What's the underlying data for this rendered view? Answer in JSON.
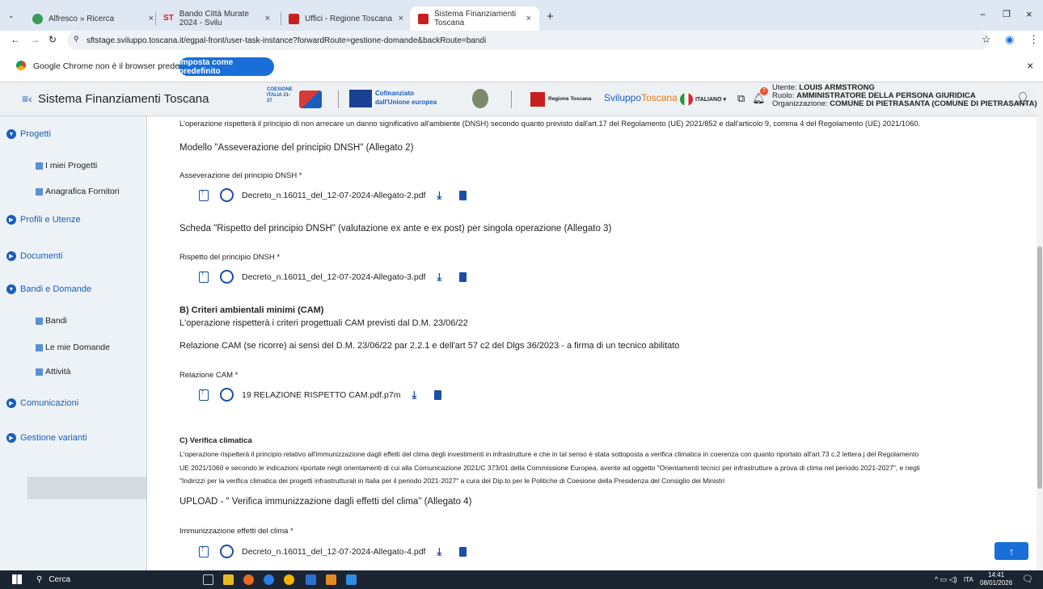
{
  "tabs": [
    {
      "label": "Alfresco » Ricerca",
      "close": "×"
    },
    {
      "label": "Bando Città Murate 2024 - Svilu",
      "close": "×"
    },
    {
      "label": "Uffici - Regione Toscana",
      "close": "×"
    },
    {
      "label": "Sistema Finanziamenti Toscana",
      "close": "×"
    }
  ],
  "new_tab": "+",
  "address": {
    "url": "sftstage.sviluppo.toscana.it/egpal-front/user-task-instance?forwardRoute=gestione-domande&backRoute=bandi"
  },
  "infobar": {
    "message": "Google Chrome non è il browser predefinito",
    "button": "Imposta come predefinito",
    "close": "×"
  },
  "header": {
    "menu_glyph": "≡‹",
    "title": "Sistema Finanziamenti Toscana",
    "logos": {
      "coesione": "COESIONE ITALIA 21-27",
      "cofin_1": "Cofinanziato",
      "cofin_2": "dall'Unione europea",
      "regione": "Regione Toscana",
      "sviluppo_a": "Sviluppo",
      "sviluppo_b": "Toscana",
      "lang": "ITALIANO"
    },
    "notif_count": "7",
    "user_label": "Utente:",
    "user": "LOUIS ARMSTRONG",
    "role_label": "Ruolo:",
    "role": "AMMINISTRATORE DELLA PERSONA GIURIDICA",
    "org_label": "Organizzazione:",
    "org": "COMUNE DI PIETRASANTA (COMUNE DI PIETRASANTA)"
  },
  "sidebar": {
    "progetti": "Progetti",
    "miei_progetti": "I miei Progetti",
    "fornitori": "Anagrafica Fornitori",
    "profili": "Profili e Utenze",
    "documenti": "Documenti",
    "bandi_domande": "Bandi e Domande",
    "bandi": "Bandi",
    "mie_domande": "Le mie Domande",
    "attivita": "Attività",
    "comunicazioni": "Comunicazioni",
    "varianti": "Gestione varianti"
  },
  "main": {
    "dnsh_text": "L'operazione rispetterà il principio di non arrecare un danno significativo all'ambiente (DNSH) secondo quanto previsto dall'art.17 del Regolamento (UE) 2021/852 e dall'articolo 9, comma 4 del Regolamento (UE) 2021/1060.",
    "modello2": "Modello \"Asseverazione del principio DNSH\" (Allegato 2)",
    "field1": "Asseverazione del principio DNSH *",
    "file1": "Decreto_n.16011_del_12-07-2024-Allegato-2.pdf",
    "scheda3": "Scheda \"Rispetto del principio DNSH\" (valutazione ex ante e ex post) per singola operazione (Allegato 3)",
    "field2": "Rispetto del principio DNSH *",
    "file2": "Decreto_n.16011_del_12-07-2024-Allegato-3.pdf",
    "cam_title": "B) Criteri ambientali minimi (CAM)",
    "cam_text": "L'operazione rispetterà i criteri progettuali CAM previsti dal D.M. 23/06/22",
    "cam_rel": "Relazione CAM (se ricorre) ai sensi del D.M. 23/06/22 par 2.2.1 e dell'art 57 c2 del Dlgs 36/2023 - a firma di un tecnico abilitato",
    "field3": "Relazione CAM *",
    "file3": "19 RELAZIONE RISPETTO CAM.pdf.p7m",
    "clima_title": "C) Verifica climatica",
    "clima_l1": "L'operazione rispetterà il principio relativo all'immunizzazione dagli effetti del clima degli investimenti in infrastrutture e che in tal senso è stata sottoposta a verifica climatica in coerenza con quanto riportato all'art.73 c.2 lettera j del Regolamento",
    "clima_l2": "UE 2021/1060 e secondo le indicazioni riportate negli orientamenti di cui alla Comunicazione 2021/C 373/01 della Commissione Europea, avente ad oggetto \"Orientamenti tecnici per infrastrutture a prova di clima nel periodo 2021-2027\", e negli",
    "clima_l3": "\"Indirizzi per la verifica climatica dei progetti infrastrutturali in Italia per il periodo 2021-2027\" a cura del Dip.to per le Politiche di Coesione della Presidenza del Consiglio dei Ministri",
    "upload4": "UPLOAD - \" Verifica immunizzazione dagli effetti del clima\" (Allegato 4)",
    "field4": "Immunizzazione effetti del clima *",
    "file4": "Decreto_n.16011_del_12-07-2024-Allegato-4.pdf"
  },
  "taskbar": {
    "search": "Cerca",
    "lang": "ITA",
    "time": "14:41",
    "date": "08/01/2026"
  },
  "scroll_top": "↑",
  "colors": {
    "accent": "#1a4fa6",
    "button": "#1a6ed8",
    "sidebar_link": "#1b5db9"
  }
}
